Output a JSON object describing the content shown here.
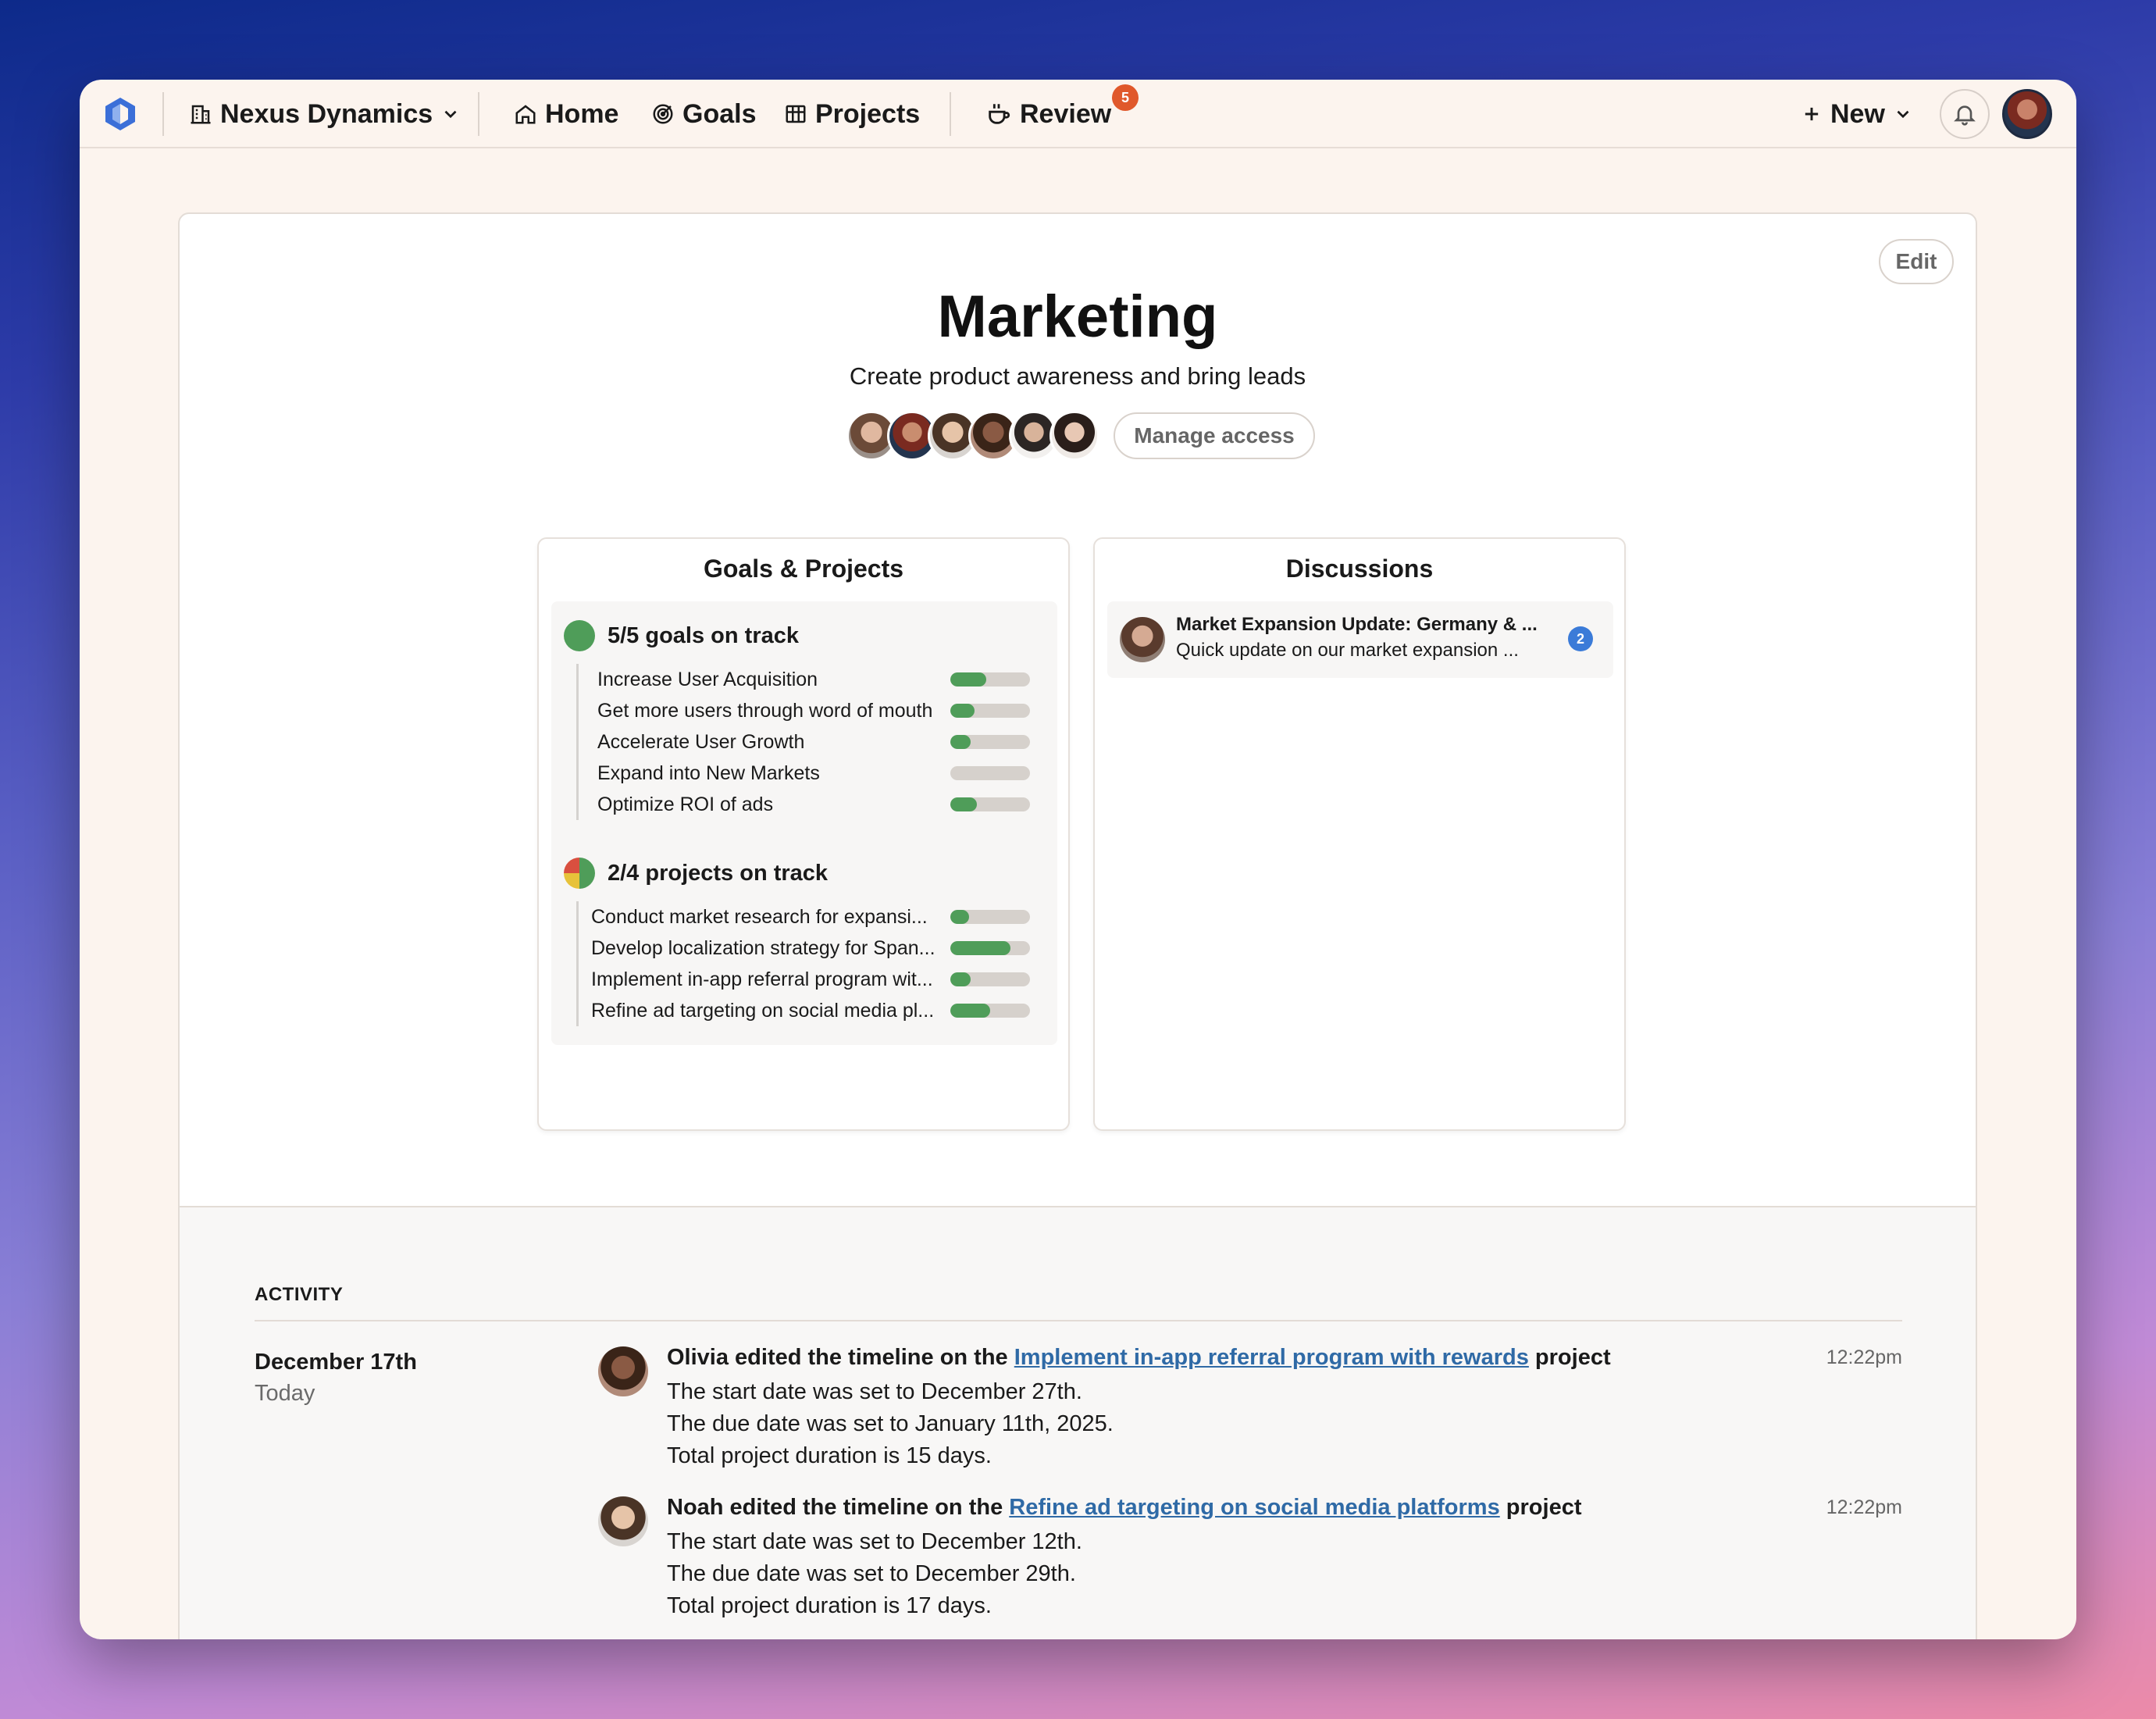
{
  "nav": {
    "company": "Nexus Dynamics",
    "home": "Home",
    "goals": "Goals",
    "projects": "Projects",
    "review": "Review",
    "review_badge": "5",
    "new": "New"
  },
  "space": {
    "title": "Marketing",
    "subtitle": "Create product awareness and bring leads",
    "edit": "Edit",
    "manage_access": "Manage access"
  },
  "goals_projects": {
    "title": "Goals & Projects",
    "goals_summary": "5/5 goals on track",
    "goals": [
      {
        "name": "Increase User Acquisition",
        "progress": 0.45
      },
      {
        "name": "Get more users through word of mouth",
        "progress": 0.3
      },
      {
        "name": "Accelerate User Growth",
        "progress": 0.25
      },
      {
        "name": "Expand into New Markets",
        "progress": 0.0
      },
      {
        "name": "Optimize ROI of ads",
        "progress": 0.33
      }
    ],
    "projects_summary": "2/4 projects on track",
    "projects": [
      {
        "name": "Conduct market research for expansi...",
        "progress": 0.24
      },
      {
        "name": "Develop localization strategy for Span...",
        "progress": 0.75
      },
      {
        "name": "Implement in-app referral program wit...",
        "progress": 0.25
      },
      {
        "name": "Refine ad targeting on social media pl...",
        "progress": 0.5
      }
    ]
  },
  "discussions": {
    "title": "Discussions",
    "items": [
      {
        "title": "Market Expansion Update: Germany & ...",
        "snippet": "Quick update on our market expansion ...",
        "count": "2"
      }
    ]
  },
  "activity": {
    "heading": "ACTIVITY",
    "date": "December 17th",
    "date_sub": "Today",
    "entries": [
      {
        "prefix": "Olivia edited the timeline on the",
        "link": "Implement in-app referral program with rewards",
        "suffix": "project",
        "time": "12:22pm",
        "lines": [
          "The start date was set to December 27th.",
          "The due date was set to January 11th, 2025.",
          "Total project duration is 15 days."
        ]
      },
      {
        "prefix": "Noah edited the timeline on the",
        "link": "Refine ad targeting on social media platforms",
        "suffix": "project",
        "time": "12:22pm",
        "lines": [
          "The start date was set to December 12th.",
          "The due date was set to December 29th.",
          "Total project duration is 17 days."
        ]
      }
    ]
  },
  "colors": {
    "on_track": "#4f9d59",
    "link": "#2f6aa6",
    "badge_orange": "#e0582b",
    "badge_blue": "#3b7bd8"
  }
}
